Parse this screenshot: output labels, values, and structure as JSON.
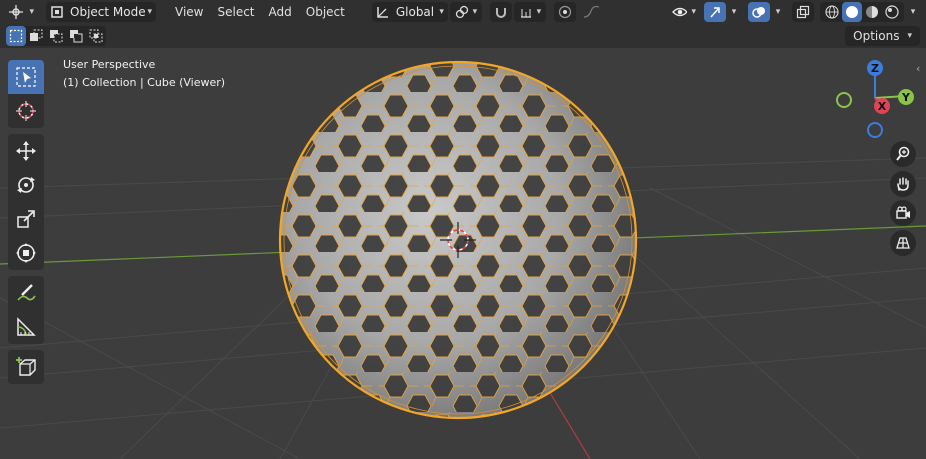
{
  "header": {
    "mode": "Object Mode",
    "menus": [
      "View",
      "Select",
      "Add",
      "Object"
    ],
    "orientation": "Global",
    "options_label": "Options"
  },
  "viewport": {
    "perspective_label": "User Perspective",
    "collection_label": "(1) Collection | Cube (Viewer)"
  },
  "gizmo": {
    "z": "Z",
    "x": "X",
    "y": "Y"
  },
  "colors": {
    "accent": "#4772b3",
    "selection_outline": "#f5a623",
    "x_axis": "#e04454",
    "y_axis": "#8bc34a",
    "z_axis": "#3b7ddd"
  }
}
